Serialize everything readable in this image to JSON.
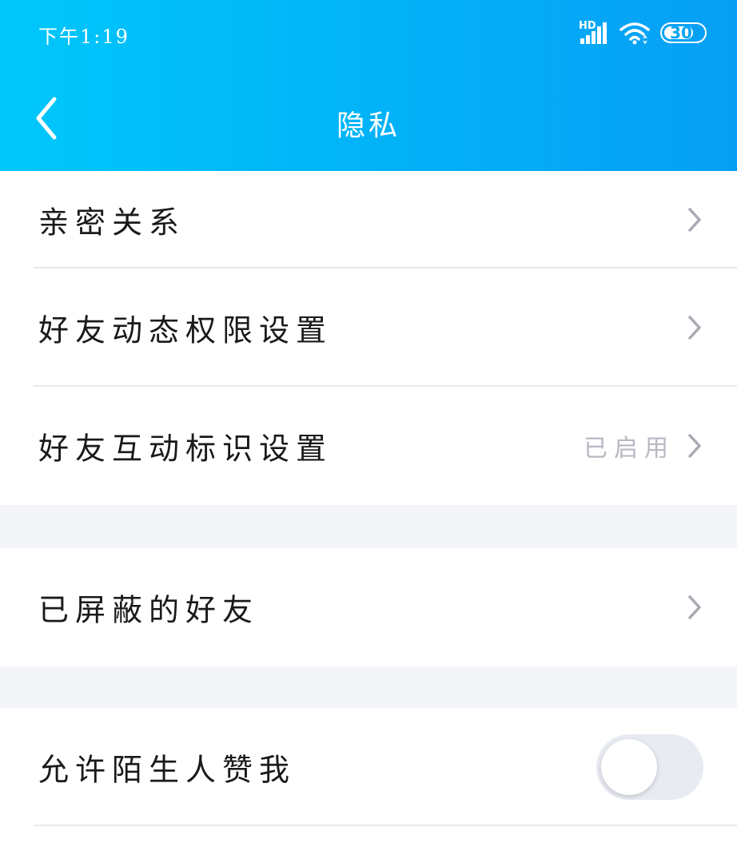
{
  "status_bar": {
    "time": "下午1:19",
    "signal_label": "HD",
    "battery": "30"
  },
  "header": {
    "title": "隐私"
  },
  "groups": [
    {
      "items": [
        {
          "label": "亲密关系",
          "value": ""
        },
        {
          "label": "好友动态权限设置",
          "value": ""
        },
        {
          "label": "好友互动标识设置",
          "value": "已启用"
        }
      ]
    },
    {
      "items": [
        {
          "label": "已屏蔽的好友",
          "value": ""
        }
      ]
    },
    {
      "items": [
        {
          "label": "允许陌生人赞我",
          "toggle": false
        }
      ]
    }
  ],
  "icons": {
    "back": "chevron-left-icon",
    "chevron": "chevron-right-icon",
    "wifi": "wifi-icon",
    "signal": "signal-icon",
    "battery": "battery-icon"
  },
  "colors": {
    "header_gradient_start": "#00c7fb",
    "header_gradient_end": "#079ff5",
    "page_background": "#f4f5f9",
    "value_text": "#b7b9c2",
    "toggle_off": "#e9ebf3"
  }
}
